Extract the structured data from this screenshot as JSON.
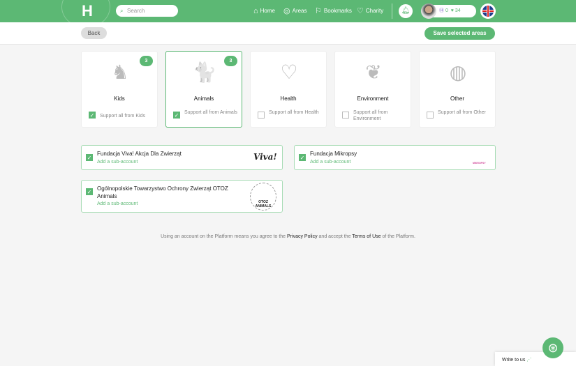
{
  "header": {
    "logo": "H",
    "search_placeholder": "Search",
    "nav": [
      {
        "label": "Home",
        "icon": "⌂"
      },
      {
        "label": "Areas",
        "icon": "◎"
      },
      {
        "label": "Bookmarks",
        "icon": "⚐"
      },
      {
        "label": "Charity",
        "icon": "♡"
      }
    ],
    "coins": "0",
    "hearts": "34"
  },
  "toolbar": {
    "back": "Back",
    "save": "Save selected areas"
  },
  "areas": [
    {
      "title": "Kids",
      "icon": "♞",
      "badge": "3",
      "support": "Support all from Kids",
      "checked": true
    },
    {
      "title": "Animals",
      "icon": "🐈",
      "badge": "3",
      "support": "Support all from Animals",
      "checked": true
    },
    {
      "title": "Health",
      "icon": "♡",
      "support": "Support all from Health",
      "checked": false
    },
    {
      "title": "Environment",
      "icon": "❦",
      "support": "Support all from Environment",
      "checked": false
    },
    {
      "title": "Other",
      "icon": "◍",
      "support": "Support all from Other",
      "checked": false
    }
  ],
  "orgs": [
    {
      "name": "Fundacja Viva! Akcja Dla Zwierząt",
      "sub": "Add a sub-account",
      "logo": "Viva!"
    },
    {
      "name": "Fundacja Mikropsy",
      "sub": "Add a sub-account",
      "logo": "MIKROPSY"
    },
    {
      "name": "Ogólnopolskie Towarzystwo Ochrony Zwierząt OTOZ Animals",
      "sub": "Add a sub-account",
      "logo": "OTOZ ANIMALS"
    }
  ],
  "footer": {
    "pre": "Using an account on the Platform means you agree to the ",
    "privacy": "Privacy Policy",
    "mid": " and accept the ",
    "terms": "Terms of Use",
    "post": " of the Platform."
  },
  "write": "Write to us",
  "colors": {
    "brand": "#5cb874"
  }
}
